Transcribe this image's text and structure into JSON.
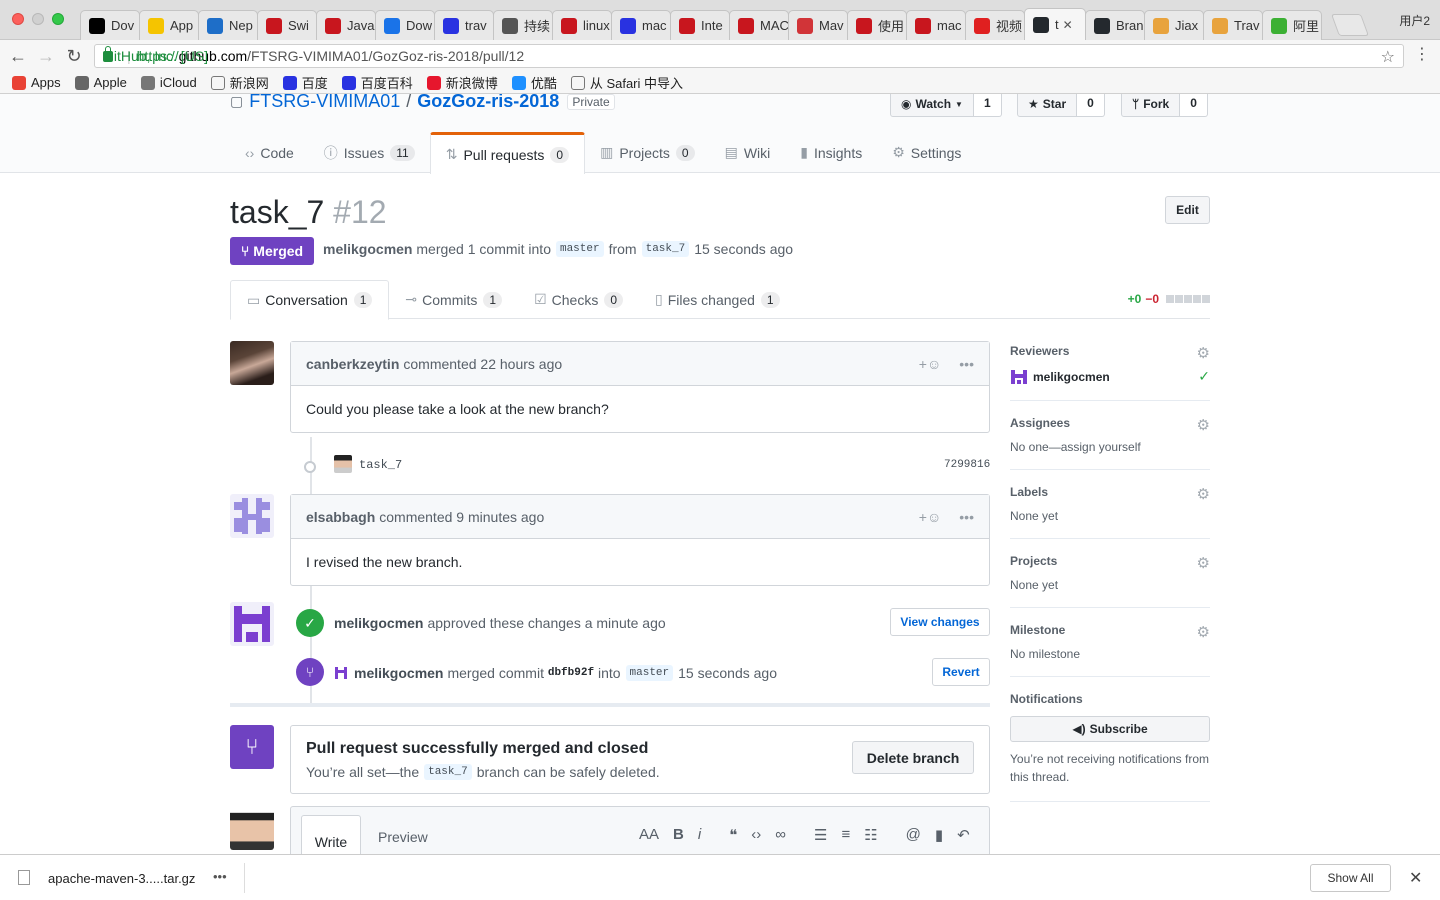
{
  "browser": {
    "tabs": [
      {
        "label": "Dov",
        "icon": "jetbrains-icon",
        "color": "#000000"
      },
      {
        "label": "App",
        "icon": "app-icon",
        "color": "#f5c400"
      },
      {
        "label": "Nep",
        "icon": "nep-icon",
        "color": "#1e6ec8"
      },
      {
        "label": "Swi",
        "icon": "csdn-icon",
        "color": "#c8161e"
      },
      {
        "label": "Java",
        "icon": "csdn-icon",
        "color": "#c8161e"
      },
      {
        "label": "Dow",
        "icon": "download-icon",
        "color": "#1a73e8"
      },
      {
        "label": "trav",
        "icon": "baidu-icon",
        "color": "#2932e1"
      },
      {
        "label": "持续",
        "icon": "jianshu-icon",
        "color": "#555555"
      },
      {
        "label": "linux",
        "icon": "csdn-icon",
        "color": "#c8161e"
      },
      {
        "label": "mac",
        "icon": "baidu-icon",
        "color": "#2932e1"
      },
      {
        "label": "Inte",
        "icon": "csdn-icon",
        "color": "#c8161e"
      },
      {
        "label": "MAC",
        "icon": "csdn-icon",
        "color": "#c8161e"
      },
      {
        "label": "Mav",
        "icon": "pen-icon",
        "color": "#d13438"
      },
      {
        "label": "使用",
        "icon": "csdn-icon",
        "color": "#c8161e"
      },
      {
        "label": "mac",
        "icon": "csdn-icon",
        "color": "#c8161e"
      },
      {
        "label": "视频",
        "icon": "video-icon",
        "color": "#e02020"
      },
      {
        "label": "t",
        "icon": "github-icon",
        "color": "#24292e",
        "active": true
      },
      {
        "label": "Bran",
        "icon": "github-icon",
        "color": "#24292e"
      },
      {
        "label": "Jiax",
        "icon": "avatar-icon",
        "color": "#e8a33d"
      },
      {
        "label": "Trav",
        "icon": "avatar-icon",
        "color": "#e8a33d"
      },
      {
        "label": "阿里",
        "icon": "wechat-icon",
        "color": "#3cb034"
      }
    ],
    "profile": "用户2",
    "url": {
      "ev": "GitHub, Inc. [US]",
      "scheme": "https://",
      "host": "github.com",
      "path": "/FTSRG-VIMIMA01/GozGoz-ris-2018/pull/12"
    },
    "bookmarks": [
      "Apps",
      "Apple",
      "iCloud",
      "新浪网",
      "百度",
      "百度百科",
      "新浪微博",
      "优酷",
      "从 Safari 中导入"
    ]
  },
  "repo": {
    "owner": "FTSRG-VIMIMA01",
    "name": "GozGoz-ris-2018",
    "visibility": "Private",
    "watch_label": "Watch",
    "watch_count": "1",
    "star_label": "Star",
    "star_count": "0",
    "fork_label": "Fork",
    "fork_count": "0",
    "nav": [
      {
        "label": "Code",
        "count": ""
      },
      {
        "label": "Issues",
        "count": "11"
      },
      {
        "label": "Pull requests",
        "count": "0"
      },
      {
        "label": "Projects",
        "count": "0"
      },
      {
        "label": "Wiki",
        "count": ""
      },
      {
        "label": "Insights",
        "count": ""
      },
      {
        "label": "Settings",
        "count": ""
      }
    ]
  },
  "pr": {
    "title": "task_7",
    "number": "#12",
    "edit_label": "Edit",
    "state": "Merged",
    "author": "melikgocmen",
    "meta_text": "merged 1 commit into",
    "base": "master",
    "from_text": "from",
    "head": "task_7",
    "time": "15 seconds ago",
    "tabs": [
      {
        "label": "Conversation",
        "count": "1"
      },
      {
        "label": "Commits",
        "count": "1"
      },
      {
        "label": "Checks",
        "count": "0"
      },
      {
        "label": "Files changed",
        "count": "1"
      }
    ],
    "additions": "+0",
    "deletions": "−0"
  },
  "timeline": {
    "comment1": {
      "author": "canberkzeytin",
      "action": "commented",
      "time": "22 hours ago",
      "body": "Could you please take a look at the new branch?"
    },
    "commit": {
      "message": "task_7",
      "sha": "7299816"
    },
    "comment2": {
      "author": "elsabbagh",
      "action": "commented",
      "time": "9 minutes ago",
      "body": "I revised the new branch."
    },
    "review": {
      "author": "melikgocmen",
      "text": "approved these changes",
      "time": "a minute ago",
      "button": "View changes"
    },
    "merge": {
      "author": "melikgocmen",
      "text": "merged commit",
      "sha": "dbfb92f",
      "into": "into",
      "branch": "master",
      "time": "15 seconds ago",
      "button": "Revert"
    },
    "mergebox": {
      "title": "Pull request successfully merged and closed",
      "text_pre": "You’re all set—the",
      "branch": "task_7",
      "text_post": "branch can be safely deleted.",
      "button": "Delete branch"
    },
    "editor": {
      "write_tab": "Write",
      "preview_tab": "Preview"
    }
  },
  "sidebar": {
    "reviewers": {
      "heading": "Reviewers",
      "name": "melikgocmen"
    },
    "assignees": {
      "heading": "Assignees",
      "text": "No one—assign yourself"
    },
    "labels": {
      "heading": "Labels",
      "text": "None yet"
    },
    "projects": {
      "heading": "Projects",
      "text": "None yet"
    },
    "milestone": {
      "heading": "Milestone",
      "text": "No milestone"
    },
    "notifications": {
      "heading": "Notifications",
      "button": "Subscribe",
      "text": "You’re not receiving notifications from this thread."
    }
  },
  "downloads": {
    "file": "apache-maven-3.....tar.gz",
    "show_all": "Show All"
  },
  "colors": {
    "merged": "#6f42c1",
    "approved": "#28a745",
    "link": "#0366d6",
    "tab_accent": "#e36209"
  }
}
